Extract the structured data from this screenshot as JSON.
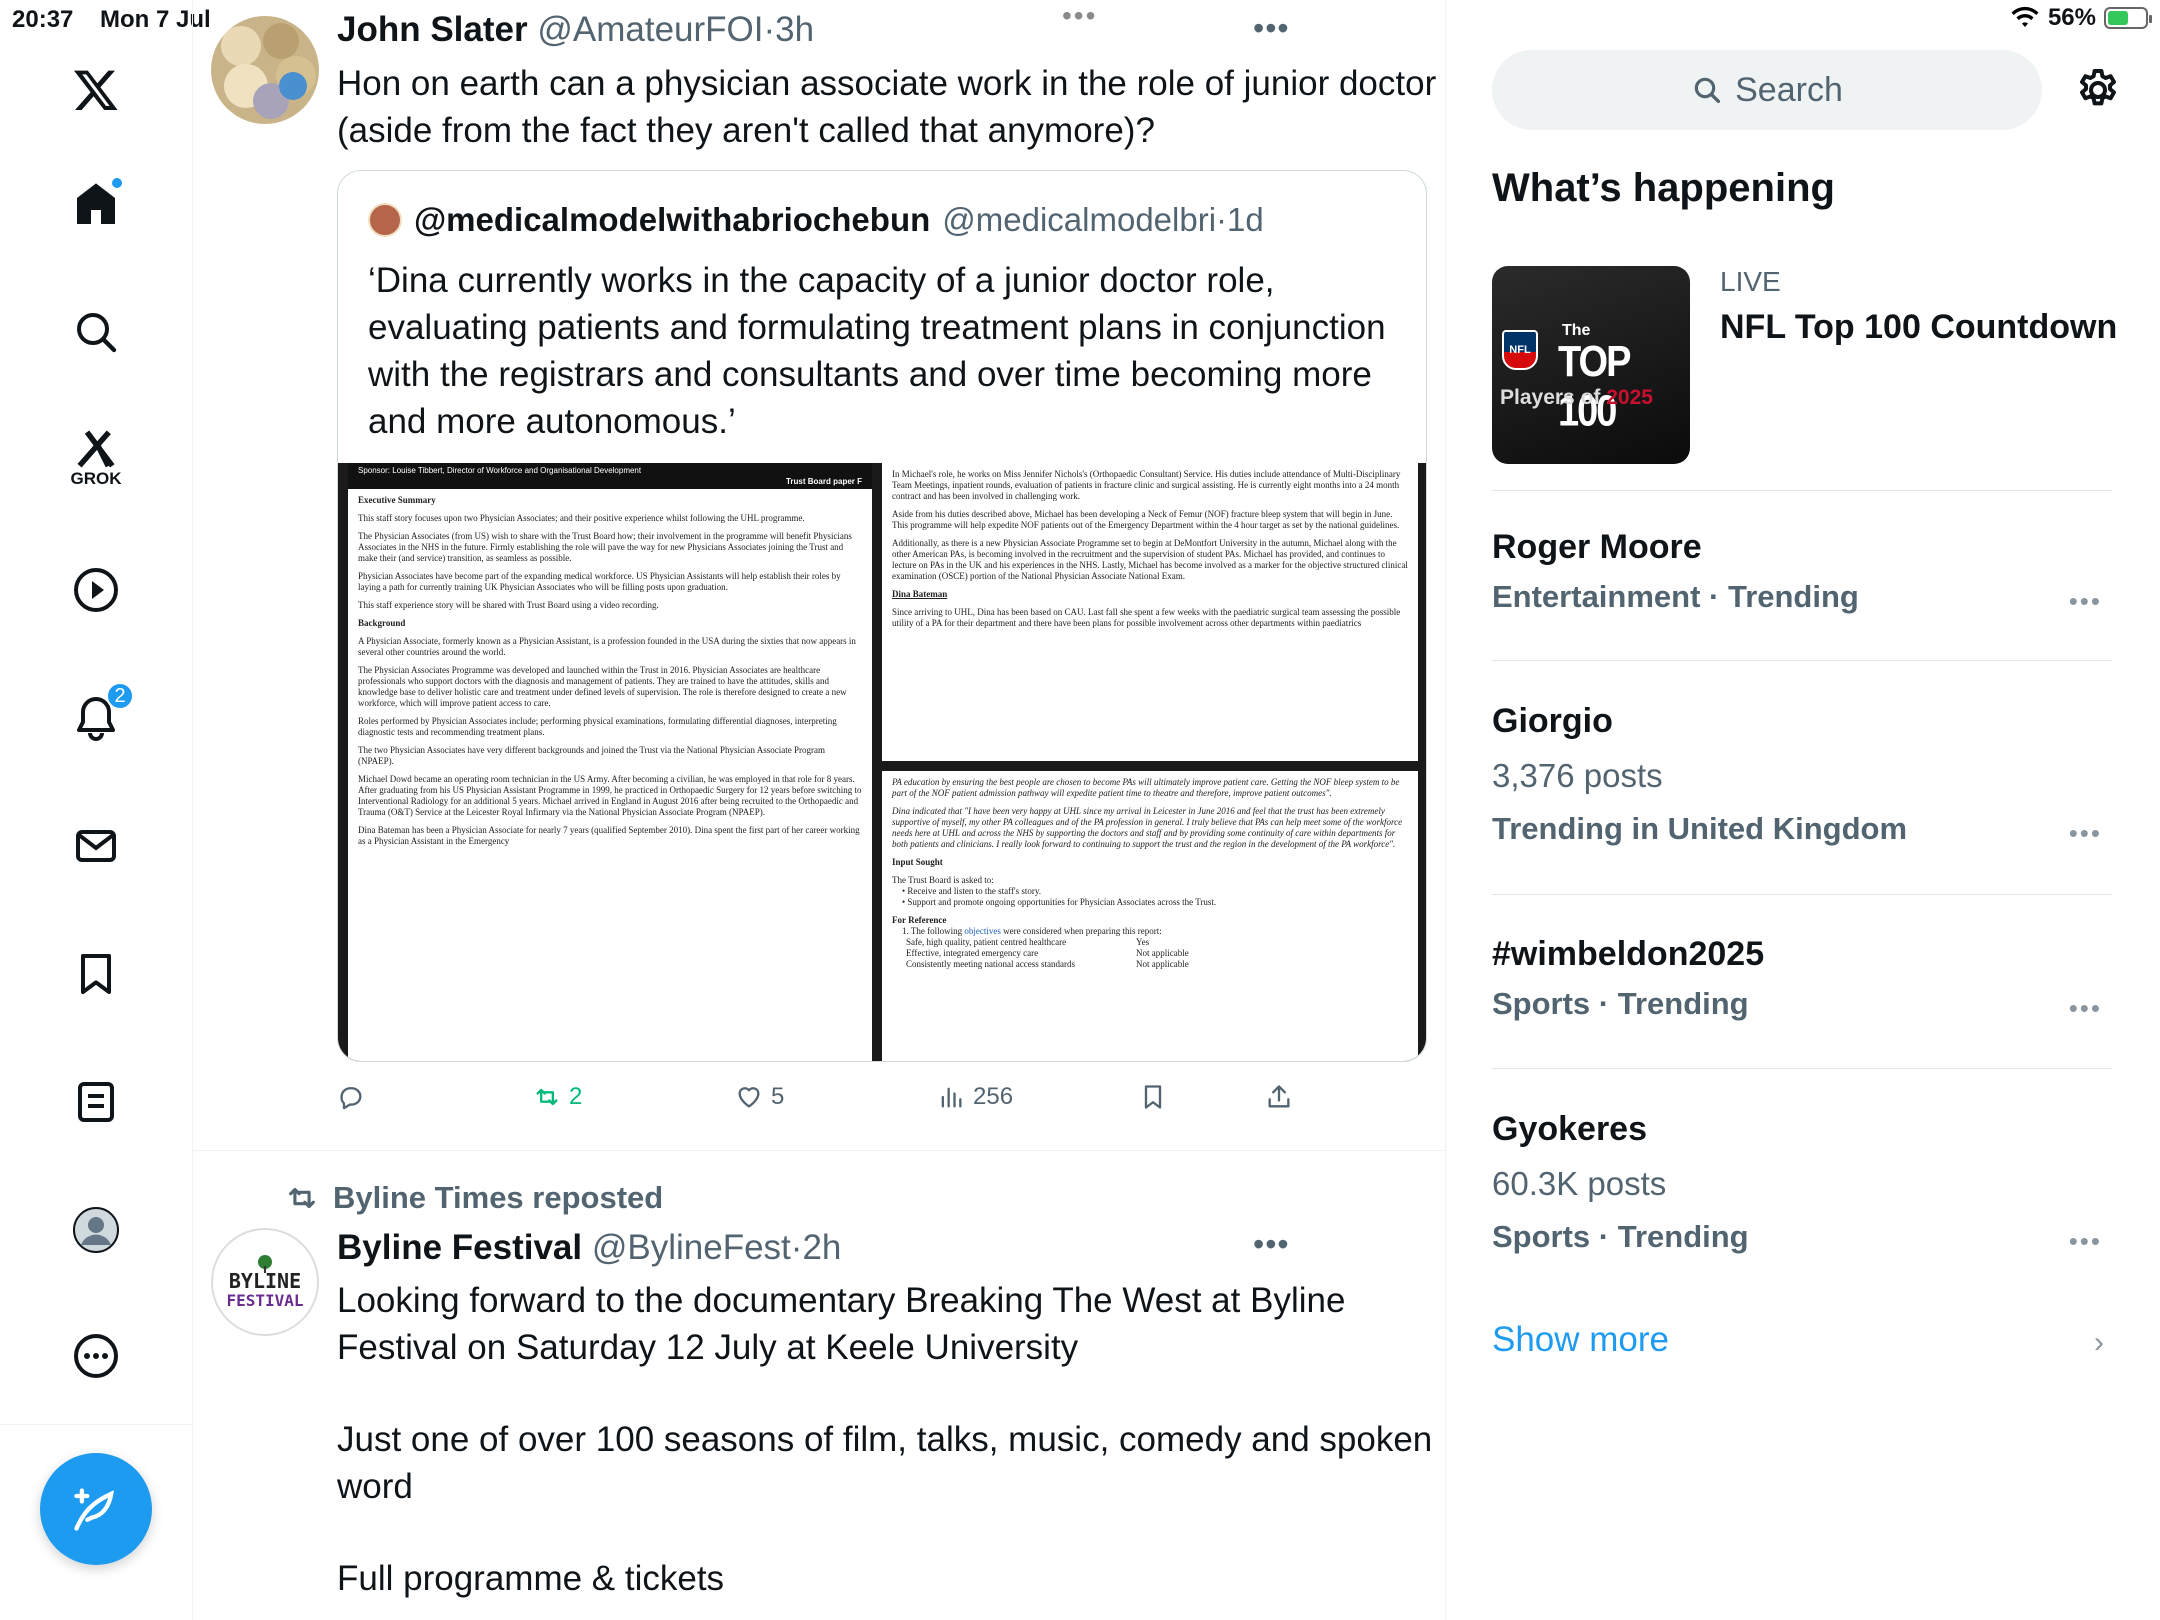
{
  "status_bar": {
    "time": "20:37",
    "date": "Mon 7 Jul",
    "battery": "56%",
    "battery_level": 0.56,
    "top_dots": "•••"
  },
  "nav": {
    "grok_label": "GROK",
    "notifications_count": "2",
    "items": [
      "x-logo",
      "home",
      "search",
      "grok",
      "video",
      "notifications",
      "messages",
      "bookmarks",
      "lists",
      "profile",
      "more"
    ]
  },
  "tweets": [
    {
      "name": "John Slater",
      "handle": "@AmateurFOI",
      "sep": "·",
      "time": "3h",
      "text_line1": "Hon on earth can a physician associate work in the role of junior doctor",
      "text_line2": "(aside from the fact they aren't called that anymore)?",
      "more": "•••",
      "quote": {
        "name": "@medicalmodelwithabriochebun",
        "handle": "@medicalmodelbri",
        "sep": "·",
        "time": "1d",
        "text_line1": "‘Dina currently works in the capacity of a junior doctor role,",
        "text_line2": "evaluating patients and formulating treatment plans in conjunction",
        "text_line3": "with the registrars and consultants and over time becoming more",
        "text_line4": "and more autonomous.’"
      },
      "doc_left": {
        "sponsor": "Sponsor: Louise Tibbert, Director of Workforce and Organisational Development",
        "paper": "Trust Board paper F",
        "h1": "Executive Summary",
        "p1": "This staff story focuses upon two Physician Associates; and their positive experience whilst following the UHL programme.",
        "p2": "The Physician Associates (from US) wish to share with the Trust Board how; their involvement in the programme will benefit Physicians Associates in the NHS in the future. Firmly establishing the role will pave the way for new Physicians Associates joining the Trust and make their (and service) transition, as seamless as possible.",
        "p3": "Physician Associates have become part of the expanding medical workforce. US Physician Assistants will help establish their roles by laying a path for currently training UK Physician Associates who will be filling posts upon graduation.",
        "p4": "This staff experience story will be shared with Trust Board using a video recording.",
        "h2": "Background",
        "p5": "A Physician Associate, formerly known as a Physician Assistant, is a profession founded in the USA during the sixties that now appears in several other countries around the world.",
        "p6": "The Physician Associates Programme was developed and launched within the Trust in 2016. Physician Associates are healthcare professionals who support doctors with the diagnosis and management of patients. They are trained to have the attitudes, skills and knowledge base to deliver holistic care and treatment under defined levels of supervision. The role is therefore designed to create a new workforce, which will improve patient access to care.",
        "p7": "Roles performed by Physician Associates include; performing physical examinations, formulating differential diagnoses, interpreting diagnostic tests and recommending treatment plans.",
        "p8": "The two Physician Associates have very different backgrounds and joined the Trust via the National Physician Associate Program (NPAEP).",
        "p9": "Michael Dowd became an operating room technician in the US Army. After becoming a civilian, he was employed in that role for 8 years. After graduating from his US Physician Assistant Programme in 1999, he practiced in Orthopaedic Surgery for 12 years before switching to Interventional Radiology for an additional 5 years. Michael arrived in England in August 2016 after being recruited to the Orthopaedic and Trauma (O&T) Service at the Leicester Royal Infirmary via the National Physician Associate Program (NPAEP).",
        "p10": "Dina Bateman has been a Physician Associate for nearly 7 years (qualified September 2010). Dina spent the first part of her career working as a Physician Assistant in the Emergency"
      },
      "doc_right_top": {
        "p1": "In Michael's role, he works on Miss Jennifer Nichols's (Orthopaedic Consultant) Service. His duties include attendance of Multi-Disciplinary Team Meetings, inpatient rounds, evaluation of patients in fracture clinic and surgical assisting. He is currently eight months into a 24 month contract and has been involved in challenging work.",
        "p2": "Aside from his duties described above, Michael has been developing a Neck of Femur (NOF) fracture bleep system that will begin in June. This programme will help expedite NOF patients out of the Emergency Department within the 4 hour target as set by the national guidelines.",
        "p3": "Additionally, as there is a new Physician Associate Programme set to begin at DeMontfort University in the autumn, Michael along with the other American PAs, is becoming involved in the recruitment and the supervision of student PAs. Michael has provided, and continues to lecture on PAs in the UK and his experiences in the NHS. Lastly, Michael has become involved as a marker for the objective structured clinical examination (OSCE) portion of the National Physician Associate National Exam.",
        "h1": "Dina Bateman",
        "p4": "Since arriving to UHL, Dina has been based on CAU. Last fall she spent a few weeks with the paediatric surgical team assessing the possible utility of a PA for their department and there have been plans for possible involvement across other departments within paediatrics"
      },
      "doc_right_bottom": {
        "p1": "PA education by ensuring the best people are chosen to become PAs will ultimately improve patient care. Getting the NOF bleep system to be part of the NOF patient admission pathway will expedite patient time to theatre and therefore, improve patient outcomes\".",
        "p2": "Dina indicated that \"I have been very happy at UHL since my arrival in Leicester in June 2016 and feel that the trust has been extremely supportive of myself, my other PA colleagues and of the PA profession in general. I truly believe that PAs can help meet some of the workforce needs here at UHL and across the NHS by supporting the doctors and staff and by providing some continuity of care within departments for both patients and clinicians. I really look forward to continuing to support the trust and the region in the development of the PA workforce\".",
        "h1": "Input Sought",
        "p3": "The Trust Board is asked to:",
        "b1": "• Receive and listen to the staff's story.",
        "b2": "• Support and promote ongoing opportunities for Physician Associates across the Trust.",
        "h2": "For Reference",
        "p4a": "1. The following ",
        "p4link": "objectives",
        "p4b": " were considered when preparing this report:",
        "r1a": "Safe, high quality, patient centred healthcare",
        "r1b": "Yes",
        "r2a": "Effective, integrated emergency care",
        "r2b": "Not applicable",
        "r3a": "Consistently meeting national access standards",
        "r3b": "Not applicable"
      },
      "actions": {
        "retweets": "2",
        "likes": "5",
        "views": "256"
      }
    },
    {
      "repost_label": "Byline Times reposted",
      "name": "Byline Festival",
      "handle": "@BylineFest",
      "sep": "·",
      "time": "2h",
      "avatar_line1": "BYLINE",
      "avatar_line2": "FESTIVAL",
      "text_line1": "Looking forward to the documentary Breaking The West at Byline",
      "text_line2": "Festival on Saturday 12 July at Keele University",
      "text_line3": "Just one of over 100 seasons of film, talks, music, comedy and spoken",
      "text_line4": "word",
      "text_line5": "Full programme & tickets",
      "more": "•••"
    }
  ],
  "sidebar": {
    "search_placeholder": "Search",
    "title": "What’s happening",
    "feature": {
      "label": "LIVE",
      "title": "NFL Top 100 Countdown",
      "thumb_line1": "The",
      "thumb_line2": "TOP 100",
      "thumb_line3a": "Players of ",
      "thumb_line3b": "2025",
      "thumb_badge": "NFL"
    },
    "trends": [
      {
        "title": "Roger Moore",
        "meta": "Entertainment · Trending"
      },
      {
        "title": "Giorgio",
        "posts": "3,376 posts",
        "meta": "Trending in United Kingdom"
      },
      {
        "title": "#wimbeldon2025",
        "meta": "Sports · Trending"
      },
      {
        "title": "Gyokeres",
        "posts": "60.3K posts",
        "meta": "Sports · Trending"
      }
    ],
    "trend_more": "•••",
    "show_more": "Show more",
    "chevron": "›"
  },
  "colors": {
    "accent": "#1d9bf0",
    "retweet": "#00ba7c",
    "muted": "#536471"
  }
}
